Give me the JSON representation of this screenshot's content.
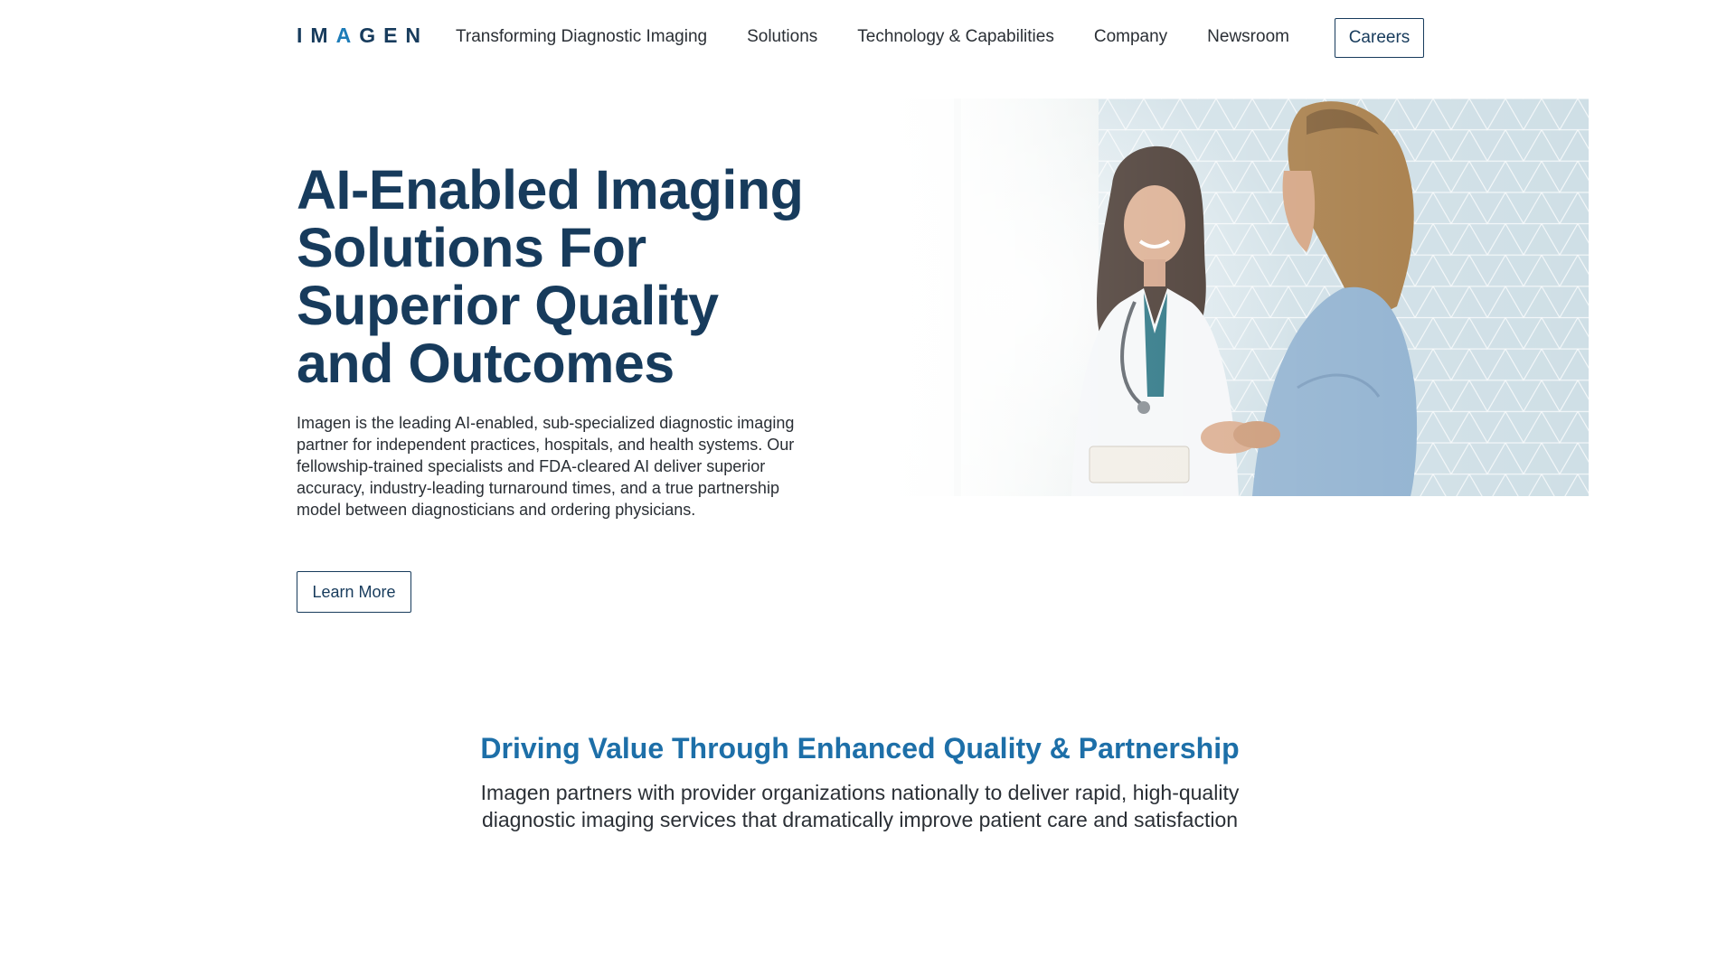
{
  "header": {
    "logo": {
      "part1": "IM",
      "accent": "A",
      "part2": "GEN"
    },
    "nav": [
      {
        "label": "Transforming Diagnostic Imaging"
      },
      {
        "label": "Solutions"
      },
      {
        "label": "Technology & Capabilities"
      },
      {
        "label": "Company"
      },
      {
        "label": "Newsroom"
      }
    ],
    "careers_label": "Careers"
  },
  "hero": {
    "title_lines": [
      "AI-Enabled Imaging",
      "Solutions For",
      "Superior Quality",
      "and Outcomes"
    ],
    "description": "Imagen is the leading AI-enabled, sub-specialized diagnostic imaging partner for independent practices, hospitals, and health systems. Our fellowship-trained specialists and FDA-cleared AI deliver superior accuracy, industry-leading turnaround times, and a true partnership model between diagnosticians and ordering physicians.",
    "cta_label": "Learn More",
    "image_alt": "Doctor in white coat talking with a patient"
  },
  "value_section": {
    "title": "Driving Value Through Enhanced Quality & Partnership",
    "description": "Imagen partners with provider organizations nationally to deliver rapid, high-quality diagnostic imaging services that dramatically improve patient care and satisfaction"
  },
  "colors": {
    "navy": "#173b5c",
    "accent_blue": "#1d6fa8",
    "text": "#2a2f35"
  }
}
